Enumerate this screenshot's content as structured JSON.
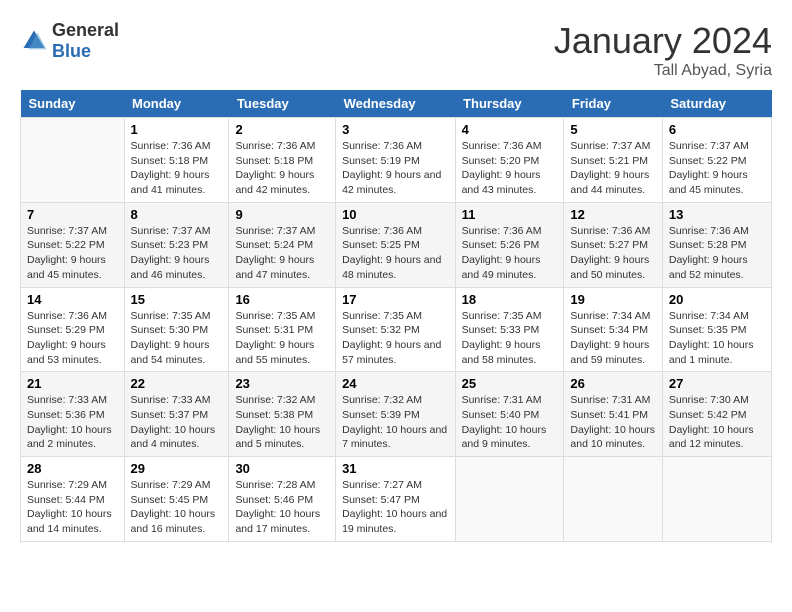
{
  "logo": {
    "text_general": "General",
    "text_blue": "Blue"
  },
  "title": "January 2024",
  "subtitle": "Tall Abyad, Syria",
  "days_of_week": [
    "Sunday",
    "Monday",
    "Tuesday",
    "Wednesday",
    "Thursday",
    "Friday",
    "Saturday"
  ],
  "weeks": [
    [
      {
        "day": "",
        "sunrise": "",
        "sunset": "",
        "daylight": ""
      },
      {
        "day": "1",
        "sunrise": "Sunrise: 7:36 AM",
        "sunset": "Sunset: 5:18 PM",
        "daylight": "Daylight: 9 hours and 41 minutes."
      },
      {
        "day": "2",
        "sunrise": "Sunrise: 7:36 AM",
        "sunset": "Sunset: 5:18 PM",
        "daylight": "Daylight: 9 hours and 42 minutes."
      },
      {
        "day": "3",
        "sunrise": "Sunrise: 7:36 AM",
        "sunset": "Sunset: 5:19 PM",
        "daylight": "Daylight: 9 hours and 42 minutes."
      },
      {
        "day": "4",
        "sunrise": "Sunrise: 7:36 AM",
        "sunset": "Sunset: 5:20 PM",
        "daylight": "Daylight: 9 hours and 43 minutes."
      },
      {
        "day": "5",
        "sunrise": "Sunrise: 7:37 AM",
        "sunset": "Sunset: 5:21 PM",
        "daylight": "Daylight: 9 hours and 44 minutes."
      },
      {
        "day": "6",
        "sunrise": "Sunrise: 7:37 AM",
        "sunset": "Sunset: 5:22 PM",
        "daylight": "Daylight: 9 hours and 45 minutes."
      }
    ],
    [
      {
        "day": "7",
        "sunrise": "Sunrise: 7:37 AM",
        "sunset": "Sunset: 5:22 PM",
        "daylight": "Daylight: 9 hours and 45 minutes."
      },
      {
        "day": "8",
        "sunrise": "Sunrise: 7:37 AM",
        "sunset": "Sunset: 5:23 PM",
        "daylight": "Daylight: 9 hours and 46 minutes."
      },
      {
        "day": "9",
        "sunrise": "Sunrise: 7:37 AM",
        "sunset": "Sunset: 5:24 PM",
        "daylight": "Daylight: 9 hours and 47 minutes."
      },
      {
        "day": "10",
        "sunrise": "Sunrise: 7:36 AM",
        "sunset": "Sunset: 5:25 PM",
        "daylight": "Daylight: 9 hours and 48 minutes."
      },
      {
        "day": "11",
        "sunrise": "Sunrise: 7:36 AM",
        "sunset": "Sunset: 5:26 PM",
        "daylight": "Daylight: 9 hours and 49 minutes."
      },
      {
        "day": "12",
        "sunrise": "Sunrise: 7:36 AM",
        "sunset": "Sunset: 5:27 PM",
        "daylight": "Daylight: 9 hours and 50 minutes."
      },
      {
        "day": "13",
        "sunrise": "Sunrise: 7:36 AM",
        "sunset": "Sunset: 5:28 PM",
        "daylight": "Daylight: 9 hours and 52 minutes."
      }
    ],
    [
      {
        "day": "14",
        "sunrise": "Sunrise: 7:36 AM",
        "sunset": "Sunset: 5:29 PM",
        "daylight": "Daylight: 9 hours and 53 minutes."
      },
      {
        "day": "15",
        "sunrise": "Sunrise: 7:35 AM",
        "sunset": "Sunset: 5:30 PM",
        "daylight": "Daylight: 9 hours and 54 minutes."
      },
      {
        "day": "16",
        "sunrise": "Sunrise: 7:35 AM",
        "sunset": "Sunset: 5:31 PM",
        "daylight": "Daylight: 9 hours and 55 minutes."
      },
      {
        "day": "17",
        "sunrise": "Sunrise: 7:35 AM",
        "sunset": "Sunset: 5:32 PM",
        "daylight": "Daylight: 9 hours and 57 minutes."
      },
      {
        "day": "18",
        "sunrise": "Sunrise: 7:35 AM",
        "sunset": "Sunset: 5:33 PM",
        "daylight": "Daylight: 9 hours and 58 minutes."
      },
      {
        "day": "19",
        "sunrise": "Sunrise: 7:34 AM",
        "sunset": "Sunset: 5:34 PM",
        "daylight": "Daylight: 9 hours and 59 minutes."
      },
      {
        "day": "20",
        "sunrise": "Sunrise: 7:34 AM",
        "sunset": "Sunset: 5:35 PM",
        "daylight": "Daylight: 10 hours and 1 minute."
      }
    ],
    [
      {
        "day": "21",
        "sunrise": "Sunrise: 7:33 AM",
        "sunset": "Sunset: 5:36 PM",
        "daylight": "Daylight: 10 hours and 2 minutes."
      },
      {
        "day": "22",
        "sunrise": "Sunrise: 7:33 AM",
        "sunset": "Sunset: 5:37 PM",
        "daylight": "Daylight: 10 hours and 4 minutes."
      },
      {
        "day": "23",
        "sunrise": "Sunrise: 7:32 AM",
        "sunset": "Sunset: 5:38 PM",
        "daylight": "Daylight: 10 hours and 5 minutes."
      },
      {
        "day": "24",
        "sunrise": "Sunrise: 7:32 AM",
        "sunset": "Sunset: 5:39 PM",
        "daylight": "Daylight: 10 hours and 7 minutes."
      },
      {
        "day": "25",
        "sunrise": "Sunrise: 7:31 AM",
        "sunset": "Sunset: 5:40 PM",
        "daylight": "Daylight: 10 hours and 9 minutes."
      },
      {
        "day": "26",
        "sunrise": "Sunrise: 7:31 AM",
        "sunset": "Sunset: 5:41 PM",
        "daylight": "Daylight: 10 hours and 10 minutes."
      },
      {
        "day": "27",
        "sunrise": "Sunrise: 7:30 AM",
        "sunset": "Sunset: 5:42 PM",
        "daylight": "Daylight: 10 hours and 12 minutes."
      }
    ],
    [
      {
        "day": "28",
        "sunrise": "Sunrise: 7:29 AM",
        "sunset": "Sunset: 5:44 PM",
        "daylight": "Daylight: 10 hours and 14 minutes."
      },
      {
        "day": "29",
        "sunrise": "Sunrise: 7:29 AM",
        "sunset": "Sunset: 5:45 PM",
        "daylight": "Daylight: 10 hours and 16 minutes."
      },
      {
        "day": "30",
        "sunrise": "Sunrise: 7:28 AM",
        "sunset": "Sunset: 5:46 PM",
        "daylight": "Daylight: 10 hours and 17 minutes."
      },
      {
        "day": "31",
        "sunrise": "Sunrise: 7:27 AM",
        "sunset": "Sunset: 5:47 PM",
        "daylight": "Daylight: 10 hours and 19 minutes."
      },
      {
        "day": "",
        "sunrise": "",
        "sunset": "",
        "daylight": ""
      },
      {
        "day": "",
        "sunrise": "",
        "sunset": "",
        "daylight": ""
      },
      {
        "day": "",
        "sunrise": "",
        "sunset": "",
        "daylight": ""
      }
    ]
  ]
}
